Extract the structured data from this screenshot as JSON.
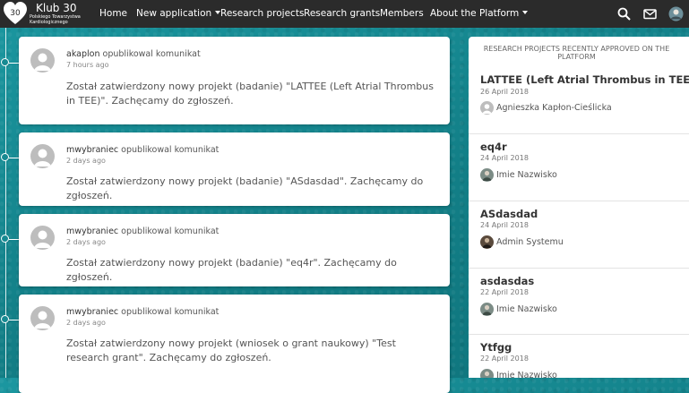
{
  "brand": {
    "logo_number": "30",
    "title": "Klub 30",
    "subtitle": "Polskiego Towarzystwa Kardiologicznego"
  },
  "nav": {
    "items": [
      {
        "label": "Home"
      },
      {
        "label": "New application"
      },
      {
        "label": "Research projects"
      },
      {
        "label": "Research grants"
      },
      {
        "label": "Members"
      },
      {
        "label": "About the Platform"
      }
    ],
    "icons": [
      "search-icon",
      "mail-icon",
      "user-avatar"
    ]
  },
  "feed": [
    {
      "author": "akaplon",
      "action": "opublikowal komunikat",
      "time": "7 hours ago",
      "message": "Został zatwierdzony nowy projekt (badanie) \"LATTEE (Left Atrial Thrombus in TEE)\". Zachęcamy do zgłoszeń."
    },
    {
      "author": "mwybraniec",
      "action": "opublikowal komunikat",
      "time": "2 days ago",
      "message": "Został zatwierdzony nowy projekt (badanie) \"ASdasdad\". Zachęcamy do zgłoszeń."
    },
    {
      "author": "mwybraniec",
      "action": "opublikowal komunikat",
      "time": "2 days ago",
      "message": "Został zatwierdzony nowy projekt (badanie) \"eq4r\". Zachęcamy do zgłoszeń."
    },
    {
      "author": "mwybraniec",
      "action": "opublikowal komunikat",
      "time": "2 days ago",
      "message": "Został zatwierdzony nowy projekt (wniosek o grant naukowy) \"Test research grant\". Zachęcamy do zgłoszeń."
    }
  ],
  "sidebar": {
    "header": "RESEARCH PROJECTS RECENTLY APPROVED ON THE PLATFORM",
    "items": [
      {
        "title": "LATTEE (Left Atrial Thrombus in TEE)",
        "date": "26 April 2018",
        "user": "Agnieszka Kapłon-Cieślicka",
        "avatar": "placeholder"
      },
      {
        "title": "eq4r",
        "date": "24 April 2018",
        "user": "Imie Nazwisko",
        "avatar": "photo"
      },
      {
        "title": "ASdasdad",
        "date": "24 April 2018",
        "user": "Admin Systemu",
        "avatar": "photo-dark"
      },
      {
        "title": "asdasdas",
        "date": "22 April 2018",
        "user": "Imie Nazwisko",
        "avatar": "photo"
      },
      {
        "title": "Ytfgg",
        "date": "22 April 2018",
        "user": "Imie Nazwisko",
        "avatar": "photo"
      }
    ]
  },
  "colors": {
    "navbar": "#2b2b2b",
    "background": "#178a92",
    "card": "#ffffff"
  }
}
